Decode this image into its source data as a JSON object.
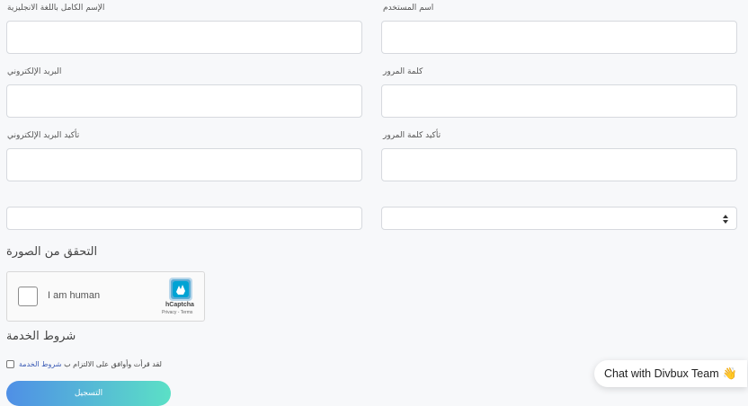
{
  "form": {
    "fullname_en_label": "الإسم الكامل باللغة الانجليزية",
    "username_label": "اسم المستخدم",
    "email_label": "البريد الإلكتروني",
    "password_label": "كلمة المرور",
    "confirm_email_label": "تأكيد البريد الإلكتروني",
    "confirm_password_label": "تأكيد كلمة المرور",
    "captcha_heading": "التحقق من الصورة",
    "terms_heading": "شروط الخدمة",
    "terms_link": "شروط الخدمة",
    "terms_text": "لقد قرأت وأوافق على الالتزام ب",
    "submit_label": "التسجيل"
  },
  "captcha": {
    "checkbox_label": "I am human",
    "brand": "hCaptcha",
    "links": "Privacy - Terms"
  },
  "chat": {
    "label": "Chat with Divbux Team",
    "emoji": "👋"
  },
  "colors": {
    "background": "#f7f8fa",
    "button_start": "#4f8fe6",
    "button_end": "#5be0c6",
    "link": "#3b5bb5"
  }
}
